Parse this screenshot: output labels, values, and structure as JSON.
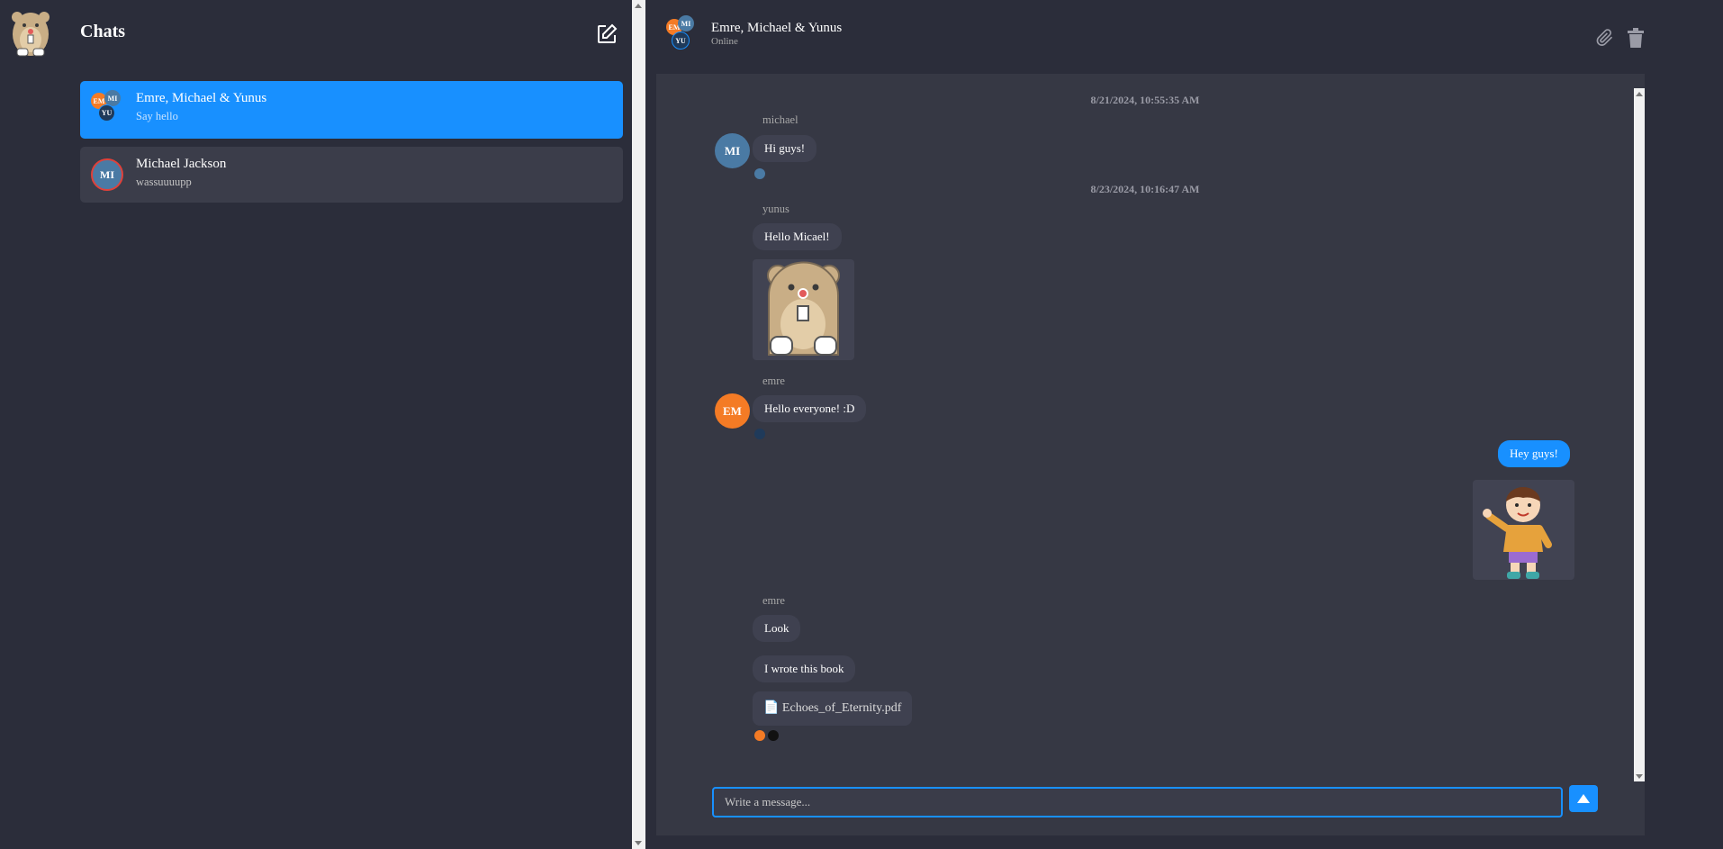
{
  "sidebar": {
    "title": "Chats",
    "chats": [
      {
        "name": "Emre, Michael & Yunus",
        "preview": "Say hello",
        "avatars": [
          "EM",
          "MI",
          "YU"
        ],
        "active": true
      },
      {
        "name": "Michael Jackson",
        "preview": "wassuuuupp",
        "avatars": [
          "MI"
        ],
        "active": false
      }
    ]
  },
  "header": {
    "title": "Emre, Michael & Yunus",
    "status": "Online",
    "avatars": [
      "EM",
      "MI",
      "YU"
    ]
  },
  "messages": {
    "timestamps": [
      "8/21/2024, 10:55:35 AM",
      "8/23/2024, 10:16:47 AM"
    ],
    "groups": [
      {
        "sender": "michael",
        "avatar": "MI",
        "texts": [
          "Hi guys!"
        ]
      },
      {
        "sender": "yunus",
        "texts": [
          "Hello Micael!"
        ],
        "sticker": "bear-sticker"
      },
      {
        "sender": "emre",
        "avatar": "EM",
        "texts": [
          "Hello everyone! :D"
        ]
      },
      {
        "sender": "me",
        "texts": [
          "Hey guys!"
        ],
        "sticker": "boy-waving-sticker"
      },
      {
        "sender": "emre",
        "texts": [
          "Look",
          "I wrote this book"
        ],
        "file": "📄 Echoes_of_Eternity.pdf"
      }
    ]
  },
  "composer": {
    "placeholder": "Write a message..."
  },
  "colors": {
    "accent": "#1890ff",
    "emre": "#f47b25",
    "michael": "#4a7aa4",
    "yunus": "#1f3a5a",
    "background": "#2b2d3a",
    "panel": "#363844",
    "bubble": "#3f4150"
  },
  "icons": [
    "app-logo-bear-icon",
    "new-chat-icon",
    "paperclip-icon",
    "trash-icon",
    "send-arrow-icon"
  ]
}
